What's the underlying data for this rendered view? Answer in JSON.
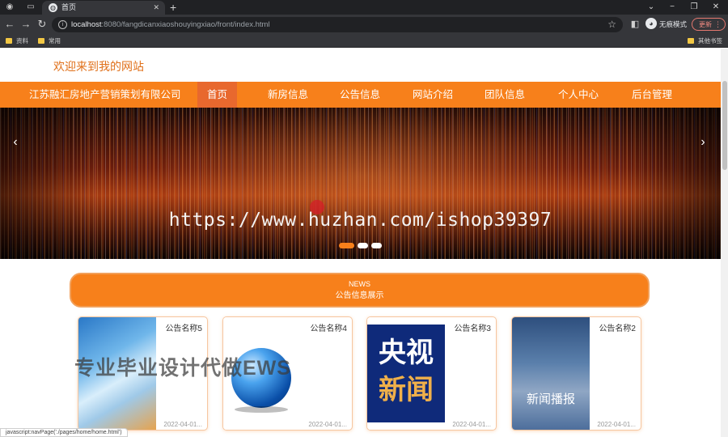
{
  "browser": {
    "active_tab_title": "首页",
    "url_host": "localhost",
    "url_rest": ":8080/fangdicanxiaoshouyingxiao/front/index.html",
    "incognito_label": "无痕模式",
    "update_label": "更新",
    "bookmarks": [
      "资料",
      "常用"
    ],
    "other_bookmarks": "其他书签",
    "status_text": "javascript:navPage('./pages/home/home.html')"
  },
  "header": {
    "welcome": "欢迎来到我的网站"
  },
  "nav": {
    "brand": "江苏融汇房地产营销策划有限公司",
    "items": [
      "首页",
      "新房信息",
      "公告信息",
      "网站介绍",
      "团队信息",
      "个人中心",
      "后台管理"
    ],
    "active_index": 0
  },
  "banner": {
    "caption": "https://www.huzhan.com/ishop39397",
    "slide_count": 3,
    "active_slide": 0
  },
  "news": {
    "label_en": "NEWS",
    "label_cn": "公告信息展示",
    "cards": [
      {
        "title": "公告名称5",
        "date": "2022-04-01..."
      },
      {
        "title": "公告名称4",
        "date": "2022-04-01..."
      },
      {
        "title": "公告名称3",
        "date": "2022-04-01..."
      },
      {
        "title": "公告名称2",
        "date": "2022-04-01..."
      }
    ],
    "card3_image_text": [
      "央视",
      "新闻"
    ],
    "card4_image_text": "新闻播报"
  },
  "watermark": "专业毕业设计代做EWS",
  "colors": {
    "accent": "#f7801b",
    "active_nav": "#e8682e",
    "welcome_text": "#e0701a"
  }
}
